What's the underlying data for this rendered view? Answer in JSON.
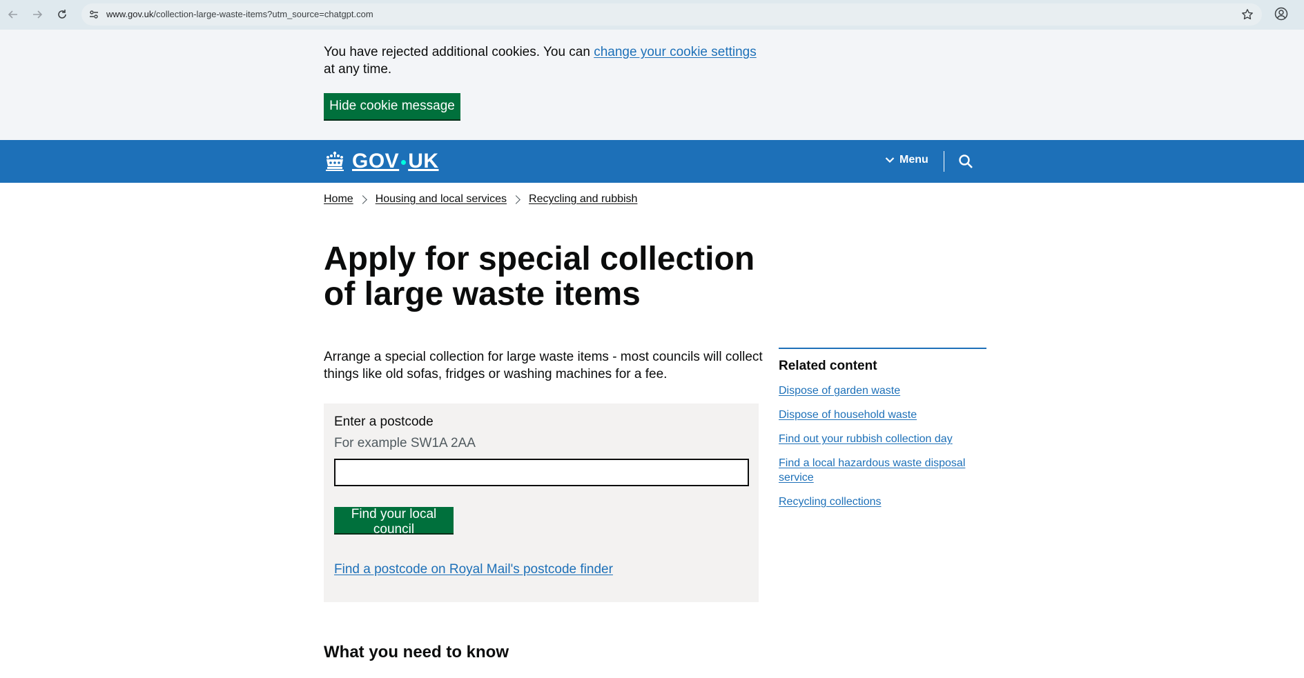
{
  "browser": {
    "url_host": "www.gov.uk",
    "url_path": "/collection-large-waste-items?utm_source=chatgpt.com"
  },
  "cookie_banner": {
    "text_before": "You have rejected additional cookies. You can ",
    "link": "change your cookie settings",
    "text_after": " at any time.",
    "hide_button": "Hide cookie message"
  },
  "header": {
    "logo_left": "GOV",
    "logo_right": "UK",
    "menu_label": "Menu"
  },
  "breadcrumbs": [
    "Home",
    "Housing and local services",
    "Recycling and rubbish"
  ],
  "page": {
    "title": "Apply for special collection of large waste items",
    "intro": "Arrange a special collection for large waste items - most councils will collect things like old sofas, fridges or washing machines for a fee."
  },
  "postcode_form": {
    "label": "Enter a postcode",
    "hint": "For example SW1A 2AA",
    "value": "",
    "submit": "Find your local council",
    "finder_link": "Find a postcode on Royal Mail's postcode finder"
  },
  "related": {
    "heading": "Related content",
    "links": [
      "Dispose of garden waste",
      "Dispose of household waste",
      "Find out your rubbish collection day",
      "Find a local hazardous waste disposal service",
      "Recycling collections"
    ]
  },
  "section_heading": "What you need to know",
  "colors": {
    "gov_blue": "#1d70b8",
    "button_green": "#00703c",
    "text": "#0b0c0c",
    "link": "#1d70b8"
  }
}
